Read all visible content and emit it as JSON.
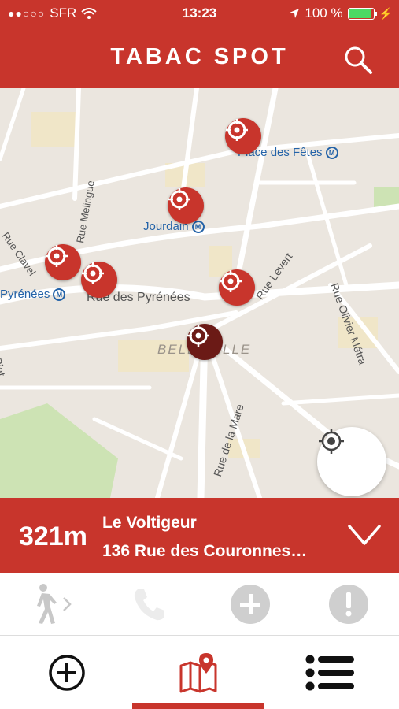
{
  "status_bar": {
    "carrier": "SFR",
    "time": "13:23",
    "battery": "100 %"
  },
  "header": {
    "title": "TABAC SPOT",
    "search_icon": "search-icon"
  },
  "map": {
    "labels": {
      "place_des_fetes": "Place des Fêtes",
      "jourdain": "Jourdain",
      "pyrenees_metro": "Pyrénées",
      "rue_clavel": "Rue Clavel",
      "rue_melingue": "Rue Melingue",
      "rue_des_pyrenees": "Rue des Pyrénées",
      "belleville": "BELLEVILLE",
      "rue_levert": "Rue Levert",
      "rue_olivier_metra": "Rue Olivier Métra",
      "rue_de_la_mare": "Rue de la Mare",
      "piat": "Piat",
      "metro_badge": "M"
    },
    "locate_icon": "crosshair-icon"
  },
  "selected_spot": {
    "distance": "321m",
    "name": "Le Voltigeur",
    "address": "136 Rue des Couronnes…"
  },
  "actions": {
    "walk_icon": "walking-person-icon",
    "phone_icon": "phone-icon",
    "add_icon": "plus-circle-icon",
    "report_icon": "exclamation-circle-icon"
  },
  "tabs": {
    "add": "plus-circle-icon",
    "map": "map-pin-icon",
    "list": "list-icon"
  },
  "colors": {
    "brand_red": "#c8352c",
    "selected_pin": "#6b1a16",
    "map_bg": "#ebe6df",
    "metro_blue": "#2463a8"
  }
}
